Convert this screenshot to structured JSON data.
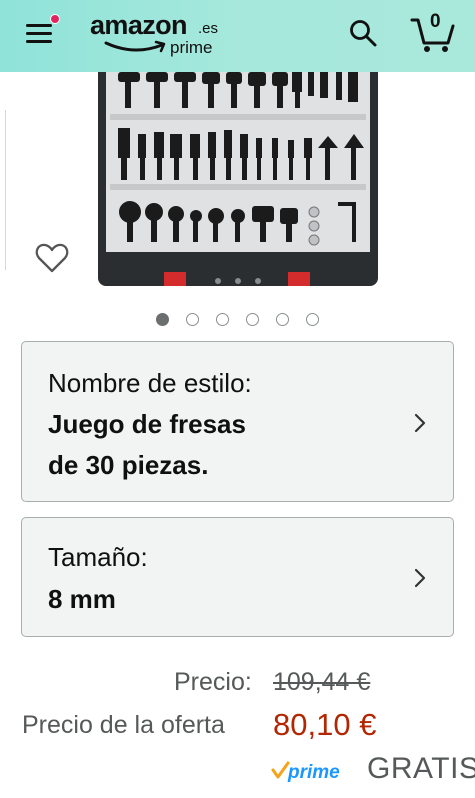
{
  "header": {
    "logo_word": "amazon",
    "logo_tld": ".es",
    "logo_sub": "prime",
    "cart_count": "0",
    "icons": [
      "menu-icon",
      "search-icon",
      "cart-icon"
    ],
    "background": "#a6e8dc",
    "notification_dot_color": "#e0245e"
  },
  "gallery": {
    "image_count": 6,
    "active_index": 0,
    "wishlist_icon": "heart-outline-icon"
  },
  "variations": {
    "style": {
      "label": "Nombre de estilo:",
      "value_line1": "Juego de fresas",
      "value_line2": "de 30 piezas."
    },
    "size": {
      "label": "Tamaño:",
      "value": "8 mm"
    },
    "chevron_icon": "chevron-right-icon"
  },
  "price": {
    "list_label": "Precio:",
    "list_price": "109,44 €",
    "deal_label": "Precio de la oferta",
    "deal_price": "80,10 €",
    "deal_color": "#b12704",
    "prime_label": "prime",
    "shipping": "GRATIS"
  }
}
